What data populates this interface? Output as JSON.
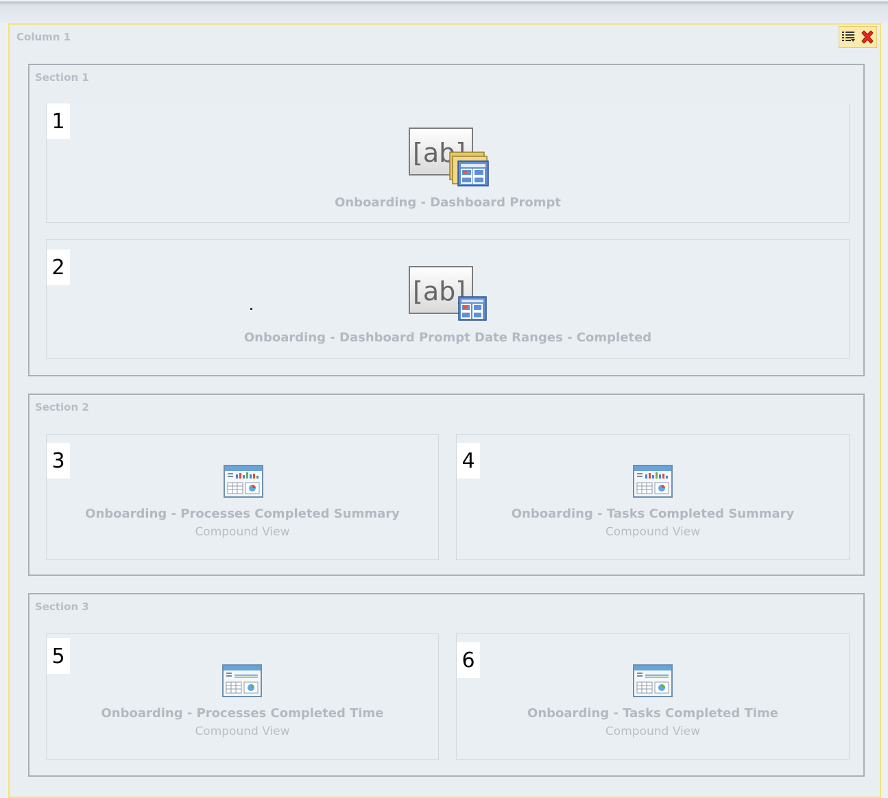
{
  "column": {
    "title": "Column 1"
  },
  "sections": [
    {
      "title": "Section 1",
      "views": [
        {
          "number": "1",
          "label": "Onboarding - Dashboard Prompt",
          "icon": "dashboard-prompt-icon"
        },
        {
          "number": "2",
          "label": "Onboarding - Dashboard Prompt Date Ranges - Completed",
          "icon": "dashboard-prompt-icon"
        }
      ]
    },
    {
      "title": "Section 2",
      "views": [
        {
          "number": "3",
          "label": "Onboarding - Processes Completed Summary",
          "sublabel": "Compound View",
          "icon": "compound-view-icon"
        },
        {
          "number": "4",
          "label": "Onboarding - Tasks Completed Summary",
          "sublabel": "Compound View",
          "icon": "compound-view-icon"
        }
      ]
    },
    {
      "title": "Section 3",
      "views": [
        {
          "number": "5",
          "label": "Onboarding - Processes Completed Time",
          "sublabel": "Compound View",
          "icon": "compound-view-icon"
        },
        {
          "number": "6",
          "label": "Onboarding - Tasks Completed Time",
          "sublabel": "Compound View",
          "icon": "compound-view-icon"
        }
      ]
    }
  ],
  "colors": {
    "column_border": "#f5e27c",
    "section_border": "#a9b0b8",
    "close_red": "#e02a1e"
  }
}
